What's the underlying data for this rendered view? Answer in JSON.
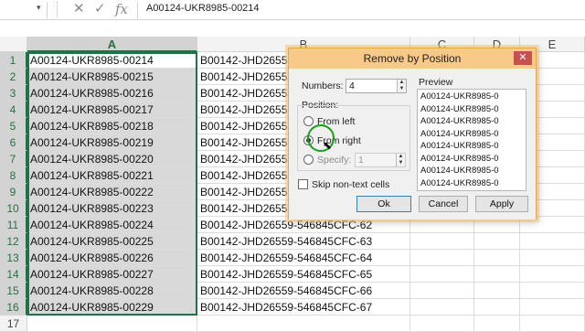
{
  "formula_bar": {
    "namebox_value": "",
    "cancel_label": "✕",
    "enter_label": "✓",
    "fx_label": "fx",
    "value": "A00124-UKR8985-00214"
  },
  "columns": [
    "A",
    "B",
    "C",
    "D",
    "E"
  ],
  "rows": [
    {
      "num": "1",
      "a": "A00124-UKR8985-00214",
      "b": "B00142-JHD26559"
    },
    {
      "num": "2",
      "a": "A00124-UKR8985-00215",
      "b": "B00142-JHD26559"
    },
    {
      "num": "3",
      "a": "A00124-UKR8985-00216",
      "b": "B00142-JHD26559"
    },
    {
      "num": "4",
      "a": "A00124-UKR8985-00217",
      "b": "B00142-JHD26559"
    },
    {
      "num": "5",
      "a": "A00124-UKR8985-00218",
      "b": "B00142-JHD26559"
    },
    {
      "num": "6",
      "a": "A00124-UKR8985-00219",
      "b": "B00142-JHD26559"
    },
    {
      "num": "7",
      "a": "A00124-UKR8985-00220",
      "b": "B00142-JHD26559"
    },
    {
      "num": "8",
      "a": "A00124-UKR8985-00221",
      "b": "B00142-JHD26559"
    },
    {
      "num": "9",
      "a": "A00124-UKR8985-00222",
      "b": "B00142-JHD26559"
    },
    {
      "num": "10",
      "a": "A00124-UKR8985-00223",
      "b": "B00142-JHD26559"
    },
    {
      "num": "11",
      "a": "A00124-UKR8985-00224",
      "b": "B00142-JHD26559-546845CFC-62"
    },
    {
      "num": "12",
      "a": "A00124-UKR8985-00225",
      "b": "B00142-JHD26559-546845CFC-63"
    },
    {
      "num": "13",
      "a": "A00124-UKR8985-00226",
      "b": "B00142-JHD26559-546845CFC-64"
    },
    {
      "num": "14",
      "a": "A00124-UKR8985-00227",
      "b": "B00142-JHD26559-546845CFC-65"
    },
    {
      "num": "15",
      "a": "A00124-UKR8985-00228",
      "b": "B00142-JHD26559-546845CFC-66"
    },
    {
      "num": "16",
      "a": "A00124-UKR8985-00229",
      "b": "B00142-JHD26559-546845CFC-67"
    },
    {
      "num": "17",
      "a": "",
      "b": ""
    }
  ],
  "dialog": {
    "title": "Remove by Position",
    "close_label": "✕",
    "numbers_label": "Numbers:",
    "numbers_value": "4",
    "position_label": "Position:",
    "from_left_label": "From left",
    "from_right_label": "From right",
    "specify_label": "Specify:",
    "specify_value": "1",
    "skip_label": "Skip non-text cells",
    "preview_label": "Preview",
    "preview_items": [
      "A00124-UKR8985-0",
      "A00124-UKR8985-0",
      "A00124-UKR8985-0",
      "A00124-UKR8985-0",
      "A00124-UKR8985-0",
      "A00124-UKR8985-0",
      "A00124-UKR8985-0",
      "A00124-UKR8985-0"
    ],
    "ok_label": "Ok",
    "cancel_label": "Cancel",
    "apply_label": "Apply",
    "selected_position": "From right"
  },
  "colors": {
    "selection_green": "#217346",
    "dialog_title": "#f9c987",
    "close_red": "#c75050"
  }
}
